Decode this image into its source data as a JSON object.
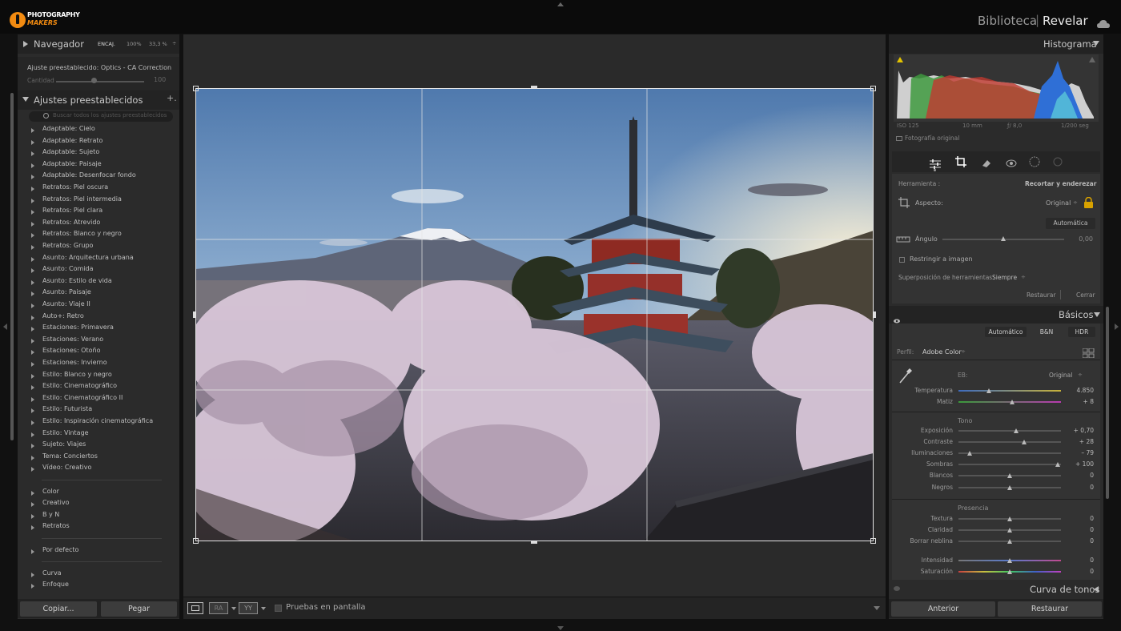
{
  "topbar": {
    "logo_line1": "PHOTOGRAPHY",
    "logo_line2": "MAKERS",
    "module_library": "Biblioteca",
    "module_separator": "|",
    "module_develop": "Revelar"
  },
  "navigator": {
    "title": "Navegador",
    "zoom_fit": "ENCAJ.",
    "zoom_100": "100%",
    "zoom_pct": "33,3 %",
    "zoom_arrow": "÷"
  },
  "preset_amount": {
    "label": "Ajuste preestablecido: Optics - CA Correction",
    "amount_label": "Cantidad",
    "amount_value": "100",
    "amount_fraction": 0.43
  },
  "presets": {
    "title": "Ajustes preestablecidos",
    "add": "+.",
    "search_placeholder": "Buscar todos los ajustes preestablecidos",
    "items": [
      "Adaptable: Cielo",
      "Adaptable: Retrato",
      "Adaptable: Sujeto",
      "Adaptable: Paisaje",
      "Adaptable: Desenfocar fondo",
      "Retratos: Piel oscura",
      "Retratos: Piel intermedia",
      "Retratos: Piel clara",
      "Retratos: Atrevido",
      "Retratos: Blanco y negro",
      "Retratos: Grupo",
      "Asunto: Arquitectura urbana",
      "Asunto: Comida",
      "Asunto: Estilo de vida",
      "Asunto: Paisaje",
      "Asunto: Viaje II",
      "Auto+: Retro",
      "Estaciones: Primavera",
      "Estaciones: Verano",
      "Estaciones: Otoño",
      "Estaciones: Invierno",
      "Estilo: Blanco y negro",
      "Estilo: Cinematográfico",
      "Estilo: Cinematográfico II",
      "Estilo: Futurista",
      "Estilo: Inspiración cinematográfica",
      "Estilo: Vintage",
      "Sujeto: Viajes",
      "Tema: Conciertos",
      "Vídeo: Creativo"
    ],
    "groups1": [
      "Color",
      "Creativo",
      "B y N",
      "Retratos"
    ],
    "groups2": [
      "Por defecto"
    ],
    "groups3": [
      "Curva",
      "Enfoque"
    ]
  },
  "left_buttons": {
    "copy": "Copiar...",
    "paste": "Pegar"
  },
  "toolbar": {
    "view1": "",
    "view2": "RA",
    "view3": "YY",
    "proof_label": "Pruebas en pantalla"
  },
  "histogram": {
    "title": "Histograma",
    "iso": "ISO 125",
    "focal": "10 mm",
    "aperture": "ƒ/ 8,0",
    "shutter": "1/200 seg",
    "original_label": "Fotografía original"
  },
  "crop": {
    "tool_label": "Herramienta :",
    "tool_name": "Recortar y enderezar",
    "aspect_label": "Aspecto:",
    "aspect_value": "Original",
    "auto": "Automática",
    "angle_label": "Ángulo",
    "angle_value": "0,00",
    "angle_fraction": 0.5,
    "constrain_label": "Restringir a imagen",
    "overlay_label": "Superposición de herramientas:",
    "overlay_value": "Siempre",
    "reset": "Restaurar",
    "close": "Cerrar"
  },
  "basic": {
    "title": "Básicos",
    "treatment_auto": "Automático",
    "treatment_bw": "B&N",
    "treatment_hdr": "HDR",
    "profile_label": "Perfil:",
    "profile_value": "Adobe Color",
    "wb_label": "EB:",
    "wb_value": "Original",
    "tone_head": "Tono",
    "presence_head": "Presencia",
    "sliders_wb": [
      {
        "label": "Temperatura",
        "value": "4.850",
        "fraction": 0.3
      },
      {
        "label": "Matiz",
        "value": "+ 8",
        "fraction": 0.52
      }
    ],
    "sliders_tone": [
      {
        "label": "Exposición",
        "value": "+ 0,70",
        "fraction": 0.56
      },
      {
        "label": "Contraste",
        "value": "+ 28",
        "fraction": 0.64
      },
      {
        "label": "Iluminaciones",
        "value": "– 79",
        "fraction": 0.11
      },
      {
        "label": "Sombras",
        "value": "+ 100",
        "fraction": 0.97
      },
      {
        "label": "Blancos",
        "value": "0",
        "fraction": 0.5
      },
      {
        "label": "Negros",
        "value": "0",
        "fraction": 0.5
      }
    ],
    "sliders_presence": [
      {
        "label": "Textura",
        "value": "0",
        "fraction": 0.5
      },
      {
        "label": "Claridad",
        "value": "0",
        "fraction": 0.5
      },
      {
        "label": "Borrar neblina",
        "value": "0",
        "fraction": 0.5
      },
      {
        "label": "Intensidad",
        "value": "0",
        "fraction": 0.5
      },
      {
        "label": "Saturación",
        "value": "0",
        "fraction": 0.5
      }
    ]
  },
  "tone_curve": {
    "title": "Curva de tonos"
  },
  "right_buttons": {
    "previous": "Anterior",
    "reset": "Restaurar"
  },
  "colors": {
    "accent": "#f28b11",
    "panel": "#2b2b2b",
    "background": "#111111"
  }
}
